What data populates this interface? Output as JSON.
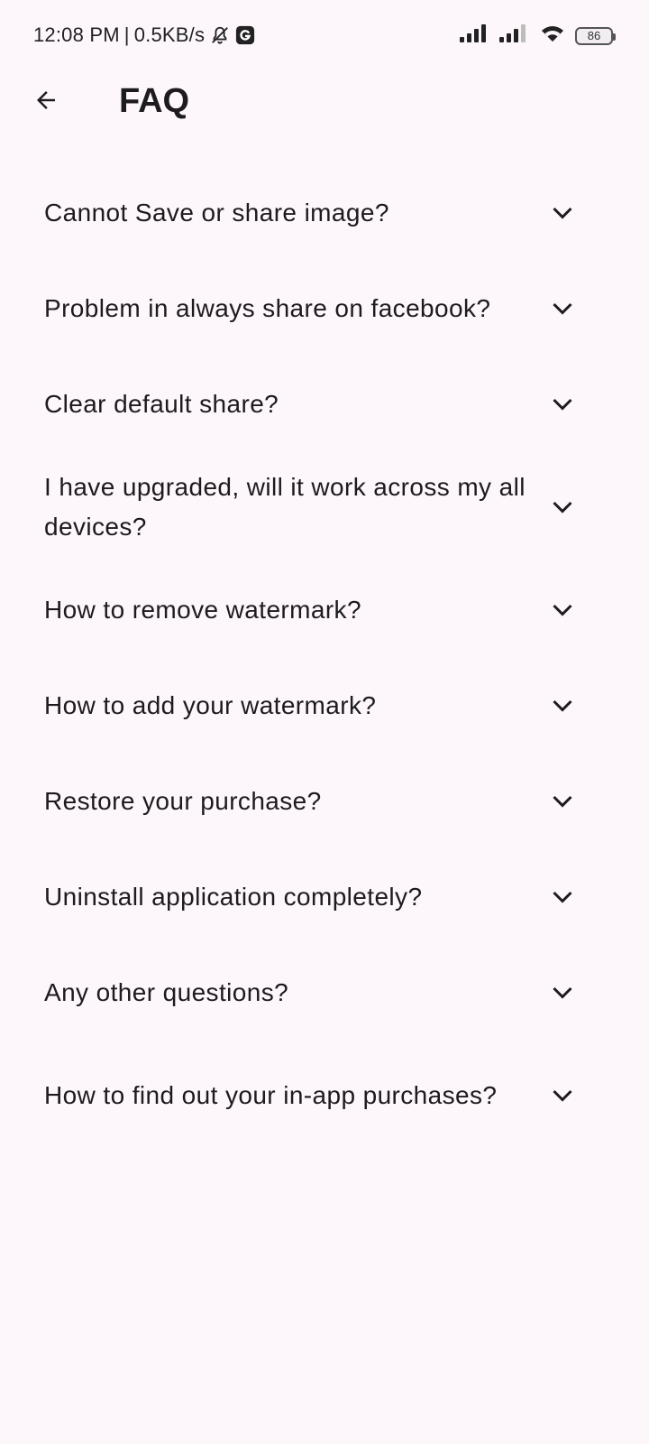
{
  "status_bar": {
    "time": "12:08 PM",
    "separator": "|",
    "speed": "0.5KB/s",
    "battery": "86",
    "icons": [
      "muted-bell-icon",
      "g-app-icon",
      "signal-icon",
      "signal-icon-2",
      "wifi-icon",
      "battery-icon"
    ]
  },
  "app_bar": {
    "title": "FAQ",
    "back_icon": "arrow-back-icon"
  },
  "faq": {
    "expand_icon": "chevron-down-icon",
    "items": [
      {
        "question": "Cannot Save or share image?"
      },
      {
        "question": "Problem in always share on facebook?"
      },
      {
        "question": "Clear default share?"
      },
      {
        "question": "I have upgraded, will it work across my all devices?"
      },
      {
        "question": "How to remove watermark?"
      },
      {
        "question": "How to add your watermark?"
      },
      {
        "question": "Restore your purchase?"
      },
      {
        "question": "Uninstall application completely?"
      },
      {
        "question": "Any other questions?"
      },
      {
        "question": "How to find out your in-app purchases?"
      }
    ]
  }
}
